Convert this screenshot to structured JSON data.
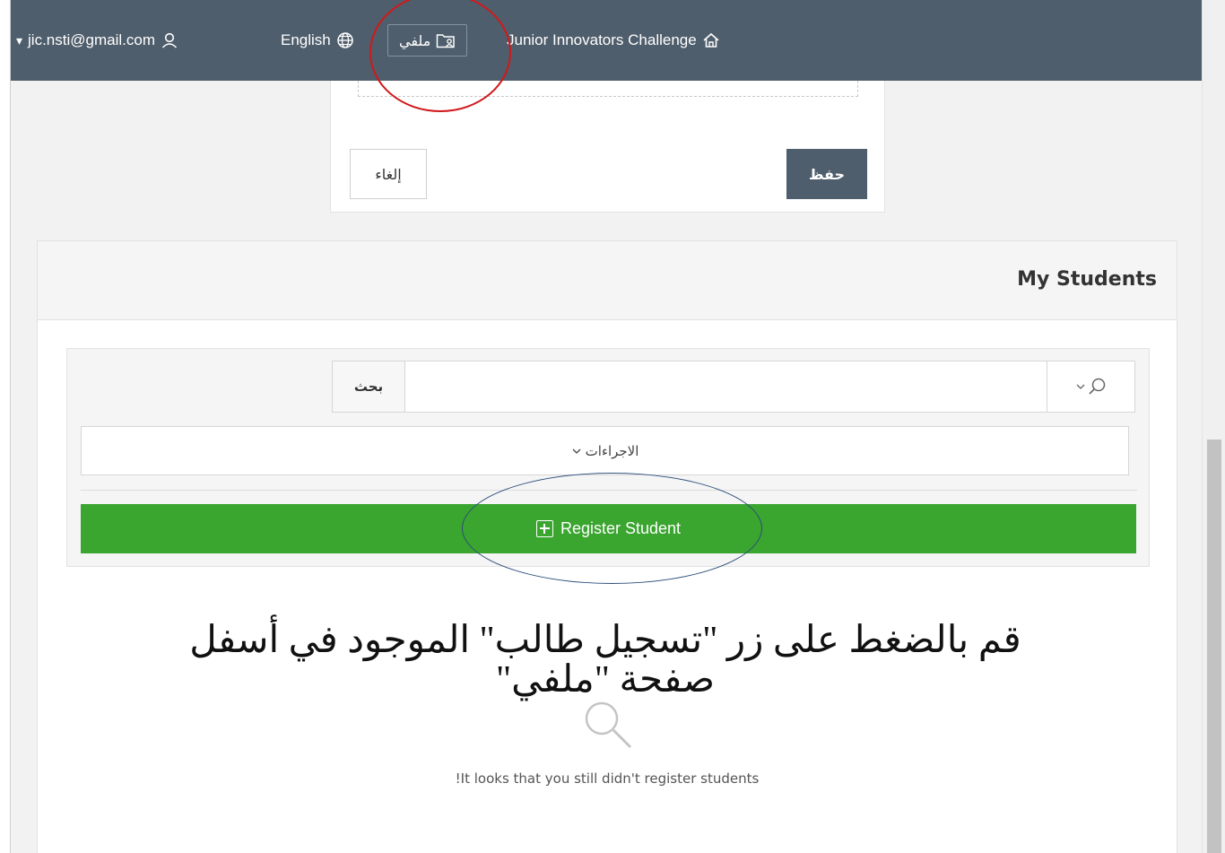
{
  "topbar": {
    "user_email": "jic.nsti@gmail.com",
    "user_caret": "▾",
    "language_label": "English",
    "profile_label": "ملفي",
    "app_title": "Junior Innovators Challenge"
  },
  "form": {
    "save_label": "حفظ",
    "cancel_label": "إلغاء"
  },
  "students_panel": {
    "title": "My Students",
    "search": {
      "button_label": "بحث",
      "value": "",
      "placeholder": ""
    },
    "actions_label": "الاجراءات",
    "register_button_label": "Register Student",
    "empty_message": "!It looks that you still didn't register students"
  },
  "annotation": {
    "instruction_text": "قم بالضغط على زر \"تسجيل طالب\" الموجود في أسفل صفحة \"ملفي\"",
    "highlight_colors": {
      "profile_circle": "#d0191b",
      "register_circle": "#2d4e7a"
    }
  },
  "icons": {
    "user": "user-icon",
    "language": "globe-icon",
    "profile": "folder-user-icon",
    "home": "home-icon",
    "search": "search-icon",
    "chevron": "chevron-down-icon",
    "add": "plus-square-icon",
    "empty": "magnifier-icon"
  },
  "colors": {
    "topbar": "#4f5e6c",
    "primary_button": "#4f5e6c",
    "register_button": "#3aa52f"
  }
}
